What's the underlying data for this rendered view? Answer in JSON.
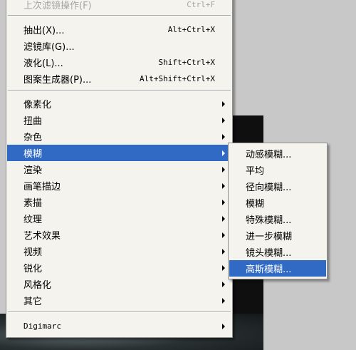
{
  "menu": {
    "last_filter": {
      "label": "上次滤镜操作(F)",
      "shortcut": "Ctrl+F"
    },
    "group1": [
      {
        "label": "抽出(X)...",
        "shortcut": "Alt+Ctrl+X"
      },
      {
        "label": "滤镜库(G)...",
        "shortcut": ""
      },
      {
        "label": "液化(L)...",
        "shortcut": "Shift+Ctrl+X"
      },
      {
        "label": "图案生成器(P)...",
        "shortcut": "Alt+Shift+Ctrl+X"
      }
    ],
    "group2": [
      {
        "label": "像素化"
      },
      {
        "label": "扭曲"
      },
      {
        "label": "杂色"
      },
      {
        "label": "模糊"
      },
      {
        "label": "渲染"
      },
      {
        "label": "画笔描边"
      },
      {
        "label": "素描"
      },
      {
        "label": "纹理"
      },
      {
        "label": "艺术效果"
      },
      {
        "label": "视频"
      },
      {
        "label": "锐化"
      },
      {
        "label": "风格化"
      },
      {
        "label": "其它"
      }
    ],
    "group3": [
      {
        "label": "Digimarc"
      }
    ]
  },
  "submenu": {
    "items": [
      {
        "label": "动感模糊..."
      },
      {
        "label": "平均"
      },
      {
        "label": "径向模糊..."
      },
      {
        "label": "模糊"
      },
      {
        "label": "特殊模糊..."
      },
      {
        "label": "进一步模糊"
      },
      {
        "label": "镜头模糊..."
      },
      {
        "label": "高斯模糊..."
      }
    ]
  },
  "colors": {
    "highlight": "#316ac5",
    "menu_bg": "#f4f3ee",
    "disabled_text": "#a5a5a5"
  }
}
